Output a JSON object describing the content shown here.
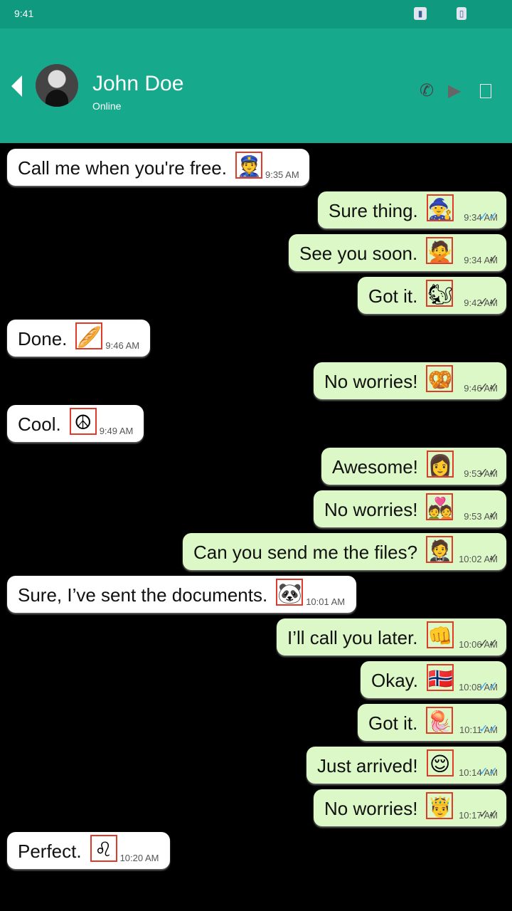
{
  "status_bar": {
    "time": "9:41",
    "signal_icon": "signal-icon",
    "battery_icon": "battery-icon"
  },
  "header": {
    "contact_name": "John Doe",
    "contact_status": "Online",
    "back_icon": "back-arrow-icon",
    "phone_icon": "phone-icon",
    "video_icon": "video-camera-icon",
    "menu_icon": "menu-icon"
  },
  "colors": {
    "header": "#17a98c",
    "status_bar": "#0f9a80",
    "outgoing": "#dcf8c6",
    "incoming": "#ffffff",
    "read_tick": "#42a5f5"
  },
  "messages": [
    {
      "direction": "in",
      "text": "Call me when you're free.",
      "emoji": "👮",
      "time": "9:35 AM"
    },
    {
      "direction": "out",
      "text": "Sure thing.",
      "emoji": "🧙",
      "time": "9:34 AM",
      "status": "read"
    },
    {
      "direction": "out",
      "text": "See you soon.",
      "emoji": "🙅",
      "time": "9:34 AM",
      "status": "sent"
    },
    {
      "direction": "out",
      "text": "Got it.",
      "emoji": "🐿",
      "time": "9:42 AM",
      "status": "delivered"
    },
    {
      "direction": "in",
      "text": "Done.",
      "emoji": "🥖",
      "time": "9:46 AM"
    },
    {
      "direction": "out",
      "text": "No worries!",
      "emoji": "🥨",
      "time": "9:46 AM",
      "status": "delivered"
    },
    {
      "direction": "in",
      "text": "Cool.",
      "emoji": "☮",
      "time": "9:49 AM"
    },
    {
      "direction": "out",
      "text": "Awesome!",
      "emoji": "👩",
      "time": "9:53 AM",
      "status": "delivered"
    },
    {
      "direction": "out",
      "text": "No worries!",
      "emoji": "💑",
      "time": "9:53 AM",
      "status": "sent"
    },
    {
      "direction": "out",
      "text": "Can you send me the files?",
      "emoji": "🤵",
      "time": "10:02 AM",
      "status": "sent"
    },
    {
      "direction": "in",
      "text": "Sure, I’ve sent the documents.",
      "emoji": "🐼",
      "time": "10:01 AM"
    },
    {
      "direction": "out",
      "text": "I’ll call you later.",
      "emoji": "👊",
      "time": "10:06 AM",
      "status": "delivered"
    },
    {
      "direction": "out",
      "text": "Okay.",
      "emoji": "🇳🇴",
      "time": "10:08 AM",
      "status": "read"
    },
    {
      "direction": "out",
      "text": "Got it.",
      "emoji": "🪼",
      "time": "10:11 AM",
      "status": "read"
    },
    {
      "direction": "out",
      "text": "Just arrived!",
      "emoji": "😌",
      "time": "10:14 AM",
      "status": "read"
    },
    {
      "direction": "out",
      "text": "No worries!",
      "emoji": "🤴",
      "time": "10:17 AM",
      "status": "delivered"
    },
    {
      "direction": "in",
      "text": "Perfect.",
      "emoji": "♌",
      "time": "10:20 AM"
    }
  ]
}
